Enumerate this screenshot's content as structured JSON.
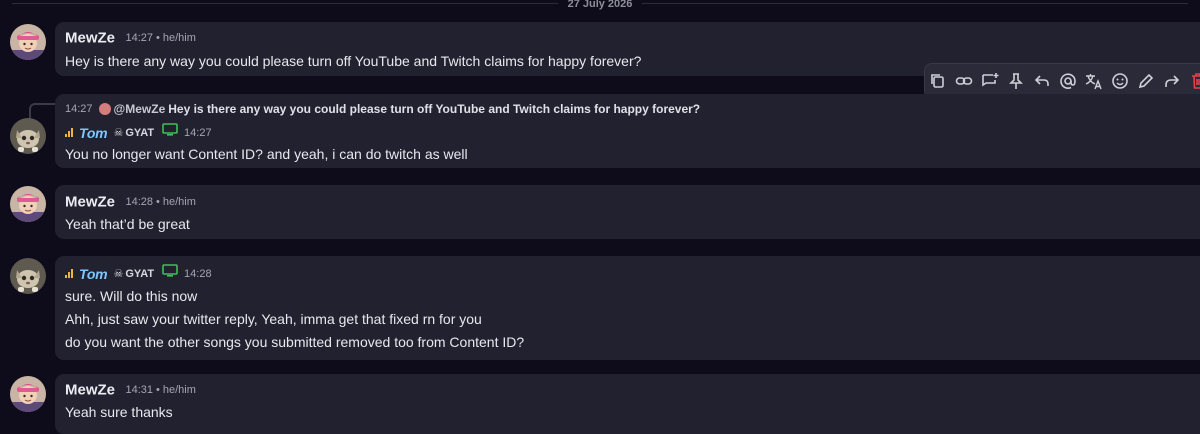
{
  "date_divider": "27 July 2026",
  "messages": [
    {
      "author": "MewZe",
      "time": "14:27",
      "pronouns": "he/him",
      "lines": [
        "Hey is there any way you could please turn off YouTube and Twitch claims for happy forever?"
      ]
    },
    {
      "reply": {
        "time": "14:27",
        "author": "@MewZe",
        "text": "Hey is there any way you could please turn off YouTube and Twitch claims for happy forever?"
      },
      "author": "Tom",
      "tag": "GYAT",
      "time": "14:27",
      "lines": [
        "You no longer want Content ID? and yeah, i can do twitch as well"
      ]
    },
    {
      "author": "MewZe",
      "time": "14:28",
      "pronouns": "he/him",
      "lines": [
        "Yeah that’d be great"
      ]
    },
    {
      "author": "Tom",
      "tag": "GYAT",
      "time": "14:28",
      "lines": [
        "sure. Will do this now",
        "Ahh, just saw your twitter reply, Yeah, imma get that fixed rn for you",
        "do you want the other songs you submitted removed too from Content ID?"
      ]
    },
    {
      "author": "MewZe",
      "time": "14:31",
      "pronouns": "he/him",
      "lines": [
        "Yeah sure thanks"
      ]
    }
  ],
  "toolbar": {
    "icons": [
      "copy-icon",
      "link-icon",
      "thread-icon",
      "pin-icon",
      "reply-icon",
      "mention-icon",
      "translate-icon",
      "emoji-icon",
      "edit-icon",
      "forward-icon",
      "delete-icon"
    ]
  },
  "colors": {
    "background": "#0e0c1a",
    "card": "#22212f",
    "tom_name": "#7ec8ff",
    "signal_bars": "#f5b13a",
    "monitor": "#3fbf5a",
    "delete": "#e8414b"
  }
}
